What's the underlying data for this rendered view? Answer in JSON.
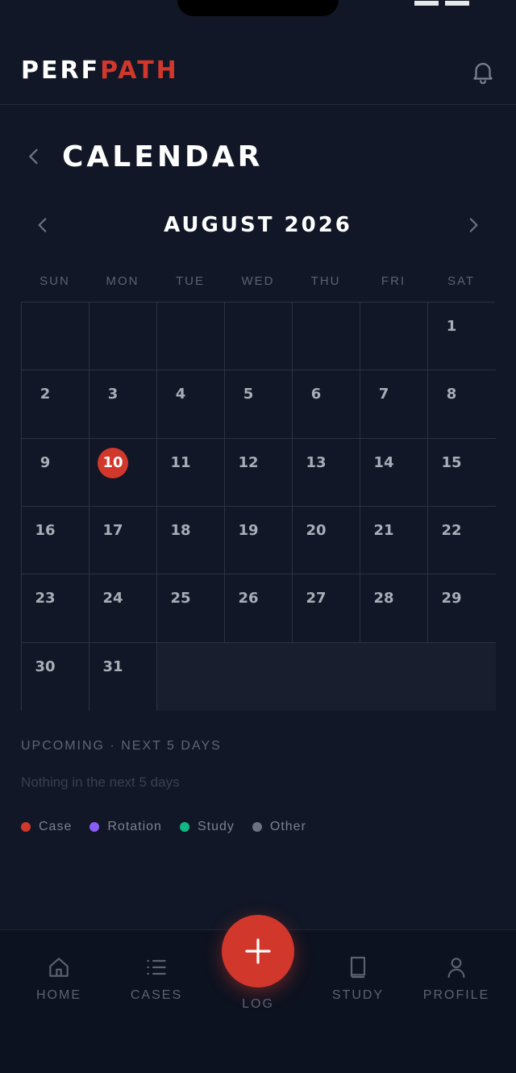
{
  "header": {
    "logo_part1": "PERF",
    "logo_part2": "PATH"
  },
  "page": {
    "title": "CALENDAR"
  },
  "calendar": {
    "month_label": "AUGUST 2026",
    "weekdays": [
      "SUN",
      "MON",
      "TUE",
      "WED",
      "THU",
      "FRI",
      "SAT"
    ],
    "days": [
      "1",
      "2",
      "3",
      "4",
      "5",
      "6",
      "7",
      "8",
      "9",
      "10",
      "11",
      "12",
      "13",
      "14",
      "15",
      "16",
      "17",
      "18",
      "19",
      "20",
      "21",
      "22",
      "23",
      "24",
      "25",
      "26",
      "27",
      "28",
      "29",
      "30",
      "31"
    ],
    "today": "10"
  },
  "upcoming": {
    "title": "UPCOMING · NEXT 5 DAYS",
    "empty_message": "Nothing in the next 5 days"
  },
  "legend": [
    {
      "label": "Case",
      "color": "#d2372b"
    },
    {
      "label": "Rotation",
      "color": "#8b5cf6"
    },
    {
      "label": "Study",
      "color": "#10b981"
    },
    {
      "label": "Other",
      "color": "#6b7280"
    }
  ],
  "nav": {
    "home": "HOME",
    "cases": "CASES",
    "log": "LOG",
    "study": "STUDY",
    "profile": "PROFILE"
  },
  "colors": {
    "accent": "#d2372b",
    "background": "#111726"
  },
  "icons": {
    "bell": "bell-icon",
    "back": "chevron-left-icon",
    "prev": "chevron-left-icon",
    "next": "chevron-right-icon",
    "home": "home-icon",
    "cases": "list-icon",
    "log": "plus-icon",
    "study": "book-icon",
    "profile": "user-icon"
  }
}
